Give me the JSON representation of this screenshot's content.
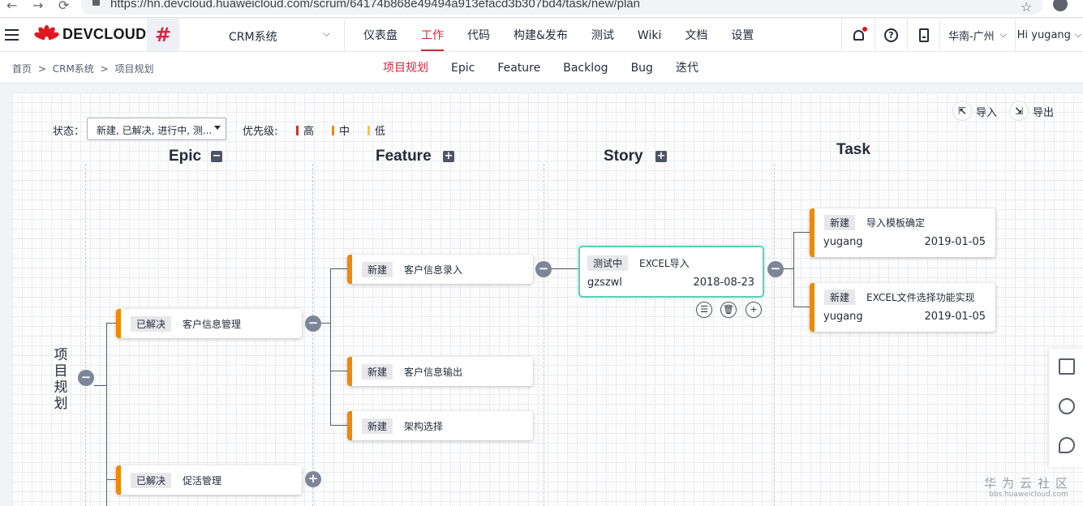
{
  "browser": {
    "url": "https://hn.devcloud.huaweicloud.com/scrum/64174b868e49494a913efacd3b307bd4/task/new/plan"
  },
  "header": {
    "logo": "DEVCLOUD",
    "project_icon": "#",
    "project": "CRM系统",
    "nav": [
      "仪表盘",
      "工作",
      "代码",
      "构建&发布",
      "测试",
      "Wiki",
      "文档",
      "设置"
    ],
    "active_nav": "工作",
    "region": "华南-广州",
    "user": "Hi yugang"
  },
  "breadcrumb": [
    "首页",
    ">",
    "CRM系统",
    ">",
    "项目规划"
  ],
  "subtabs": [
    "项目规划",
    "Epic",
    "Feature",
    "Backlog",
    "Bug",
    "迭代"
  ],
  "filters": {
    "status_label": "状态：",
    "status_value": "新建, 已解决, 进行中, 测...",
    "priority_label": "优先级:",
    "priorities": [
      {
        "label": "高",
        "color": "#c0392b"
      },
      {
        "label": "中",
        "color": "#f08800"
      },
      {
        "label": "低",
        "color": "#f5c842"
      }
    ]
  },
  "actions": {
    "import": "导入",
    "export": "导出"
  },
  "columns": {
    "epic": "Epic",
    "feature": "Feature",
    "story": "Story",
    "task": "Task"
  },
  "root": {
    "label": "项目规划"
  },
  "epics": [
    {
      "status": "已解决",
      "title": "客户信息管理"
    },
    {
      "status": "已解决",
      "title": "促活管理"
    }
  ],
  "features": [
    {
      "status": "新建",
      "title": "客户信息录入"
    },
    {
      "status": "新建",
      "title": "客户信息输出"
    },
    {
      "status": "新建",
      "title": "架构选择"
    }
  ],
  "story": {
    "status": "测试中",
    "title": "EXCEL导入",
    "owner": "gzszwl",
    "date": "2018-08-23"
  },
  "tasks": [
    {
      "status": "新建",
      "title": "导入模板确定",
      "owner": "yugang",
      "date": "2019-01-05"
    },
    {
      "status": "新建",
      "title": "EXCEL文件选择功能实现",
      "owner": "yugang",
      "date": "2019-01-05"
    }
  ],
  "toggles": {
    "minus": "−",
    "plus": "+"
  },
  "story_actions": {
    "list": "☰",
    "delete": "🗑",
    "add": "+"
  },
  "watermark": {
    "big": "华为云社区",
    "small": "bbs.huaweicloud.com"
  },
  "accent_color": "#d6273e",
  "card_accent": "#f08800",
  "story_border": "#5ad1b2"
}
